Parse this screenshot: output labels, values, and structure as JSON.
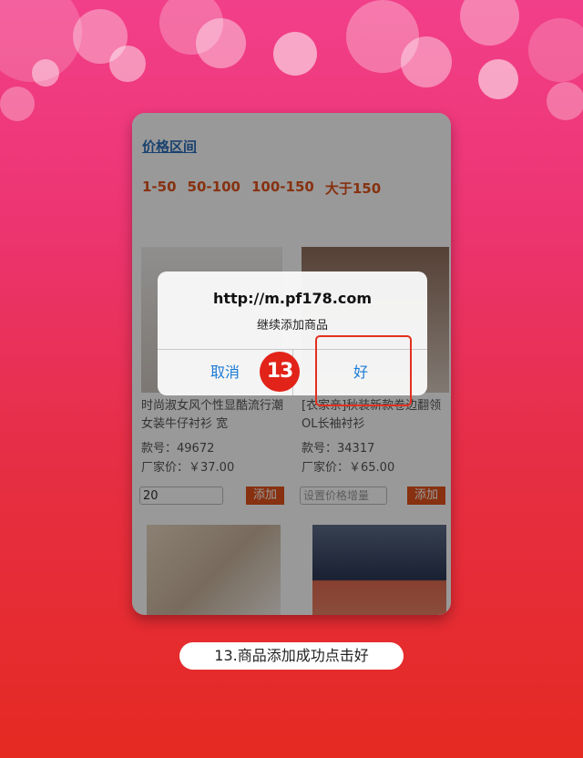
{
  "price_section": {
    "title": "价格区间",
    "ranges": [
      "1-50",
      "50-100",
      "100-150",
      "大于150"
    ]
  },
  "products": [
    {
      "title": "时尚淑女风个性显酷流行潮 女装牛仔衬衫 宽",
      "sku": "款号：49672",
      "price": "厂家价：￥37.00",
      "qty_value": "20",
      "add_label": "添加"
    },
    {
      "title": "[衣家亲]秋装新款卷边翻领OL长袖衬衫",
      "sku": "款号：34317",
      "price": "厂家价：￥65.00",
      "qty_placeholder": "设置价格增量",
      "add_label": "添加"
    }
  ],
  "dialog": {
    "title": "http://m.pf178.com",
    "message": "继续添加商品",
    "cancel_label": "取消",
    "ok_label": "好"
  },
  "step_badge": "13",
  "caption": "13.商品添加成功点击好",
  "colors": {
    "accent_orange": "#e2531c",
    "link_blue": "#1a7bd6",
    "highlight_red": "#e2301e"
  }
}
